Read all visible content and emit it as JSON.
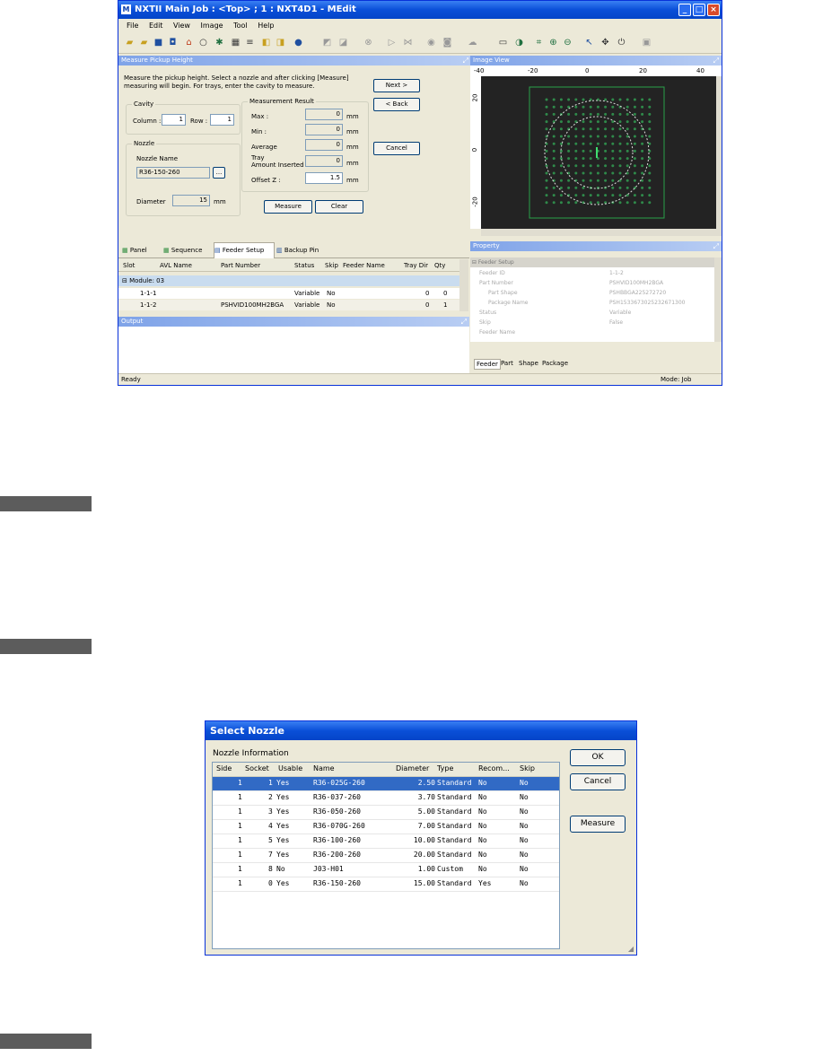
{
  "window": {
    "title": "NXTII Main Job : <Top> ; 1 : NXT4D1 - MEdit",
    "menu": [
      "File",
      "Edit",
      "View",
      "Image",
      "Tool",
      "Help"
    ],
    "status_left": "Ready",
    "status_right": "Mode: Job"
  },
  "measure_pane": {
    "title": "Measure Pickup Height",
    "instructions": "Measure the pickup height. Select a nozzle and after clicking [Measure] measuring will begin. For trays, enter the cavity to measure.",
    "cavity": {
      "title": "Cavity",
      "column_label": "Column :",
      "column_value": "1",
      "row_label": "Row :",
      "row_value": "1"
    },
    "nozzle": {
      "title": "Nozzle",
      "name_label": "Nozzle Name",
      "name_value": "R36-150-260",
      "browse_label": "...",
      "diameter_label": "Diameter",
      "diameter_value": "15",
      "diameter_unit": "mm"
    },
    "result": {
      "title": "Measurement Result",
      "max_label": "Max :",
      "max_value": "0",
      "max_unit": "mm",
      "min_label": "Min :",
      "min_value": "0",
      "min_unit": "mm",
      "avg_label": "Average",
      "avg_value": "0",
      "avg_unit": "mm",
      "tray_label1": "Tray",
      "tray_label2": "Amount Inserted :",
      "tray_value": "0",
      "tray_unit": "mm",
      "offset_label": "Offset Z :",
      "offset_value": "1.5",
      "offset_unit": "mm"
    },
    "buttons": {
      "next": "Next >",
      "back": "< Back",
      "cancel": "Cancel",
      "measure": "Measure",
      "clear": "Clear"
    }
  },
  "image_view": {
    "title": "Image View",
    "ruler_labels": [
      "-40",
      "-20",
      "0",
      "20",
      "40"
    ],
    "vruler_labels": [
      "20",
      "0",
      "-20"
    ]
  },
  "bottom_tabs": [
    "Panel",
    "Sequence",
    "Feeder Setup",
    "Backup Pin"
  ],
  "feeder_grid": {
    "headers": [
      "Slot",
      "AVL Name",
      "Part Number",
      "Status",
      "Skip",
      "Feeder Name",
      "Tray Dir",
      "Qty"
    ],
    "group": "Module: 03",
    "rows": [
      {
        "slot": "1-1-1",
        "avl": "",
        "part": "",
        "status": "Variable",
        "skip": "No",
        "feeder": "",
        "traydir": "0",
        "qty": "0"
      },
      {
        "slot": "1-1-2",
        "avl": "",
        "part": "PSHVID100MH2BGA",
        "status": "Variable",
        "skip": "No",
        "feeder": "",
        "traydir": "0",
        "qty": "1"
      }
    ]
  },
  "output_title": "Output",
  "property": {
    "title": "Property",
    "section": "Feeder Setup",
    "rows": [
      {
        "k": "Feeder ID",
        "v": "1-1-2"
      },
      {
        "k": "Part Number",
        "v": "PSHVID100MH2BGA"
      },
      {
        "k": "Part Shape",
        "v": "PSHBBGA225272720"
      },
      {
        "k": "Package Name",
        "v": "PSH1533673025232671300"
      },
      {
        "k": "Status",
        "v": "Variable"
      },
      {
        "k": "Skip",
        "v": "False"
      },
      {
        "k": "Feeder Name",
        "v": ""
      }
    ],
    "tabs": [
      "Feeder",
      "Part",
      "Shape",
      "Package"
    ]
  },
  "dialog": {
    "title": "Select Nozzle",
    "group_label": "Nozzle Information",
    "headers": [
      "Side",
      "Socket",
      "Usable",
      "Name",
      "Diameter",
      "Type",
      "Recom...",
      "Skip"
    ],
    "rows": [
      [
        "1",
        "1",
        "Yes",
        "R36-025G-260",
        "2.50",
        "Standard",
        "No",
        "No"
      ],
      [
        "1",
        "2",
        "Yes",
        "R36-037-260",
        "3.70",
        "Standard",
        "No",
        "No"
      ],
      [
        "1",
        "3",
        "Yes",
        "R36-050-260",
        "5.00",
        "Standard",
        "No",
        "No"
      ],
      [
        "1",
        "4",
        "Yes",
        "R36-070G-260",
        "7.00",
        "Standard",
        "No",
        "No"
      ],
      [
        "1",
        "5",
        "Yes",
        "R36-100-260",
        "10.00",
        "Standard",
        "No",
        "No"
      ],
      [
        "1",
        "7",
        "Yes",
        "R36-200-260",
        "20.00",
        "Standard",
        "No",
        "No"
      ],
      [
        "1",
        "8",
        "No",
        "J03-H01",
        "1.00",
        "Custom",
        "No",
        "No"
      ],
      [
        "1",
        "0",
        "Yes",
        "R36-150-260",
        "15.00",
        "Standard",
        "Yes",
        "No"
      ]
    ],
    "selected_row": 0,
    "buttons": {
      "ok": "OK",
      "cancel": "Cancel",
      "measure": "Measure"
    }
  }
}
